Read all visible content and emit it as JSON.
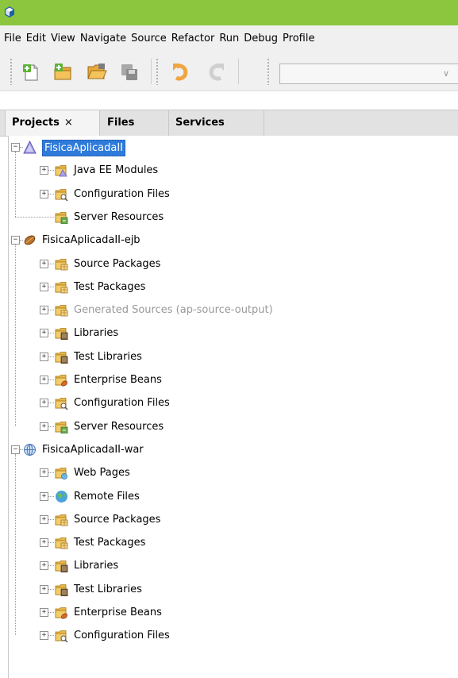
{
  "colors": {
    "titlebar": "#8cc63e",
    "selection": "#2f7bdb",
    "folder": "#e8b84a"
  },
  "menu": [
    "File",
    "Edit",
    "View",
    "Navigate",
    "Source",
    "Refactor",
    "Run",
    "Debug",
    "Profile"
  ],
  "toolbar": {
    "icons": [
      "new-file-icon",
      "new-project-icon",
      "open-project-icon",
      "save-all-icon",
      "undo-icon",
      "redo-icon"
    ],
    "config_value": ""
  },
  "tabs": {
    "projects": "Projects",
    "projects_close": "×",
    "files": "Files",
    "services": "Services"
  },
  "projects": [
    {
      "name": "FisicaAplicadaII",
      "icon": "enterprise-app-icon",
      "selected": true,
      "children": [
        {
          "label": "Java EE Modules",
          "icon": "javaee-modules-icon",
          "expandable": true
        },
        {
          "label": "Configuration Files",
          "icon": "config-files-icon",
          "expandable": true
        },
        {
          "label": "Server Resources",
          "icon": "server-resources-icon",
          "expandable": false
        }
      ]
    },
    {
      "name": "FisicaAplicadaII-ejb",
      "icon": "ejb-module-icon",
      "selected": false,
      "children": [
        {
          "label": "Source Packages",
          "icon": "package-folder-icon",
          "expandable": true
        },
        {
          "label": "Test Packages",
          "icon": "package-folder-icon",
          "expandable": true
        },
        {
          "label": "Generated Sources (ap-source-output)",
          "icon": "package-folder-icon",
          "expandable": true,
          "dim": true
        },
        {
          "label": "Libraries",
          "icon": "libraries-icon",
          "expandable": true
        },
        {
          "label": "Test Libraries",
          "icon": "libraries-icon",
          "expandable": true
        },
        {
          "label": "Enterprise Beans",
          "icon": "beans-icon",
          "expandable": true
        },
        {
          "label": "Configuration Files",
          "icon": "config-files-icon",
          "expandable": true
        },
        {
          "label": "Server Resources",
          "icon": "server-resources-icon",
          "expandable": true
        }
      ]
    },
    {
      "name": "FisicaAplicadaII-war",
      "icon": "web-module-icon",
      "selected": false,
      "children": [
        {
          "label": "Web Pages",
          "icon": "web-pages-icon",
          "expandable": true
        },
        {
          "label": "Remote Files",
          "icon": "remote-files-icon",
          "expandable": true
        },
        {
          "label": "Source Packages",
          "icon": "package-folder-icon",
          "expandable": true
        },
        {
          "label": "Test Packages",
          "icon": "package-folder-icon",
          "expandable": true
        },
        {
          "label": "Libraries",
          "icon": "libraries-icon",
          "expandable": true
        },
        {
          "label": "Test Libraries",
          "icon": "libraries-icon",
          "expandable": true
        },
        {
          "label": "Enterprise Beans",
          "icon": "beans-icon",
          "expandable": true
        },
        {
          "label": "Configuration Files",
          "icon": "config-files-icon",
          "expandable": true
        }
      ]
    }
  ]
}
